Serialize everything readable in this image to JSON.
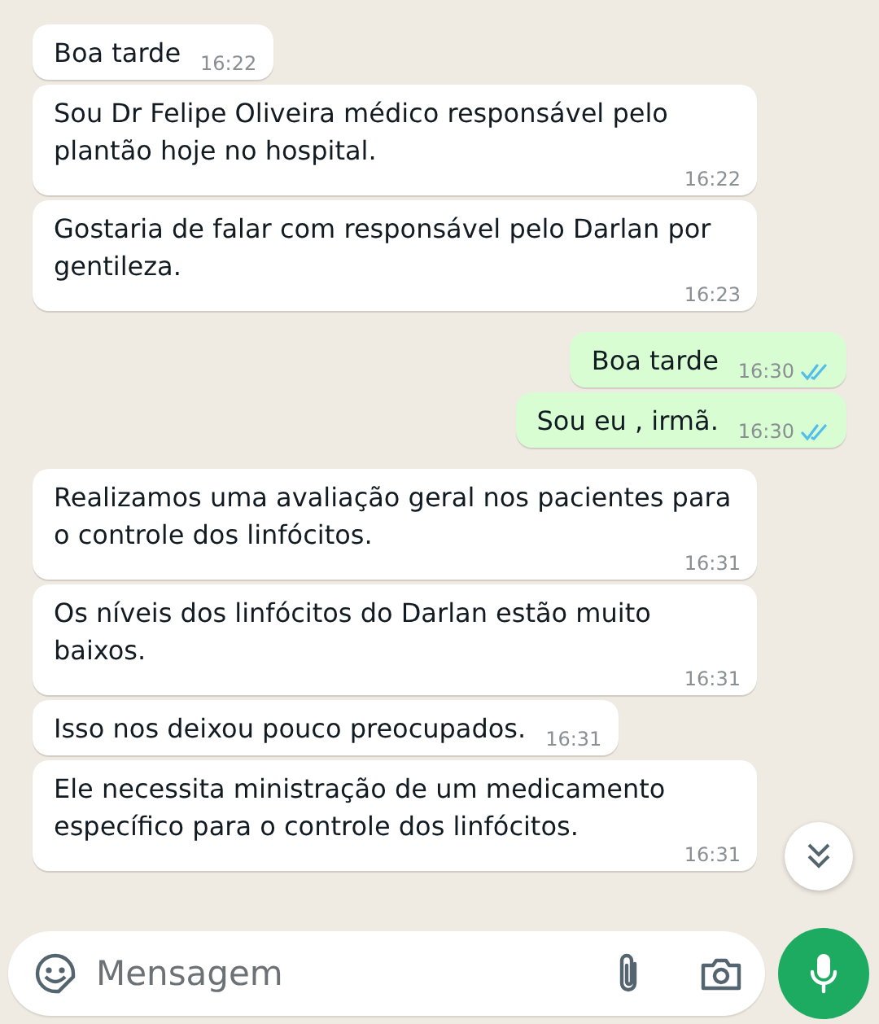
{
  "messages": [
    {
      "kind": "in",
      "text": "Boa tarde",
      "time": "16:22"
    },
    {
      "kind": "in",
      "text": "Sou Dr Felipe Oliveira médico responsável pelo plantão hoje no hospital.",
      "time": "16:22"
    },
    {
      "kind": "in",
      "text": "Gostaria de falar com responsável pelo Darlan por gentileza.",
      "time": "16:23"
    },
    {
      "kind": "out",
      "text": "Boa tarde",
      "time": "16:30",
      "read": true
    },
    {
      "kind": "out",
      "text": "Sou eu , irmã.",
      "time": "16:30",
      "read": true
    },
    {
      "kind": "in",
      "text": "Realizamos uma avaliação geral nos pacientes para o controle dos linfócitos.",
      "time": "16:31"
    },
    {
      "kind": "in",
      "text": "Os níveis dos linfócitos do Darlan estão muito baixos.",
      "time": "16:31"
    },
    {
      "kind": "in",
      "text": "Isso nos deixou pouco preocupados.",
      "time": "16:31"
    },
    {
      "kind": "in",
      "text": "Ele necessita ministração de um medicamento específico para o controle dos linfócitos.",
      "time": "16:31"
    }
  ],
  "composer": {
    "placeholder": "Mensagem"
  }
}
